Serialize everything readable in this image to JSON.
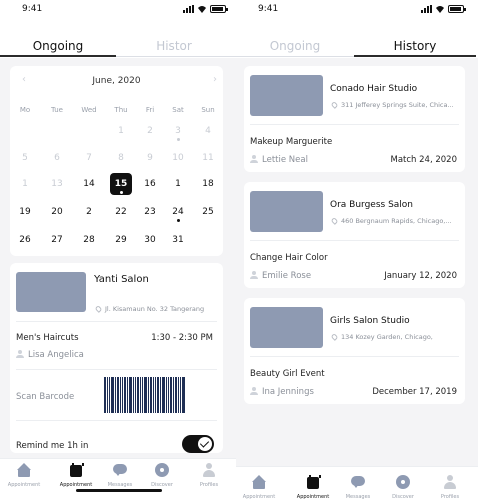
{
  "status_time": "9:41",
  "left": {
    "tabs": [
      {
        "label": "Ongoing"
      },
      {
        "label": "Histor"
      }
    ],
    "calendar": {
      "month": "June, 2020",
      "days_of_week": [
        "Mo",
        "Tue",
        "Wed",
        "Thu",
        "Fri",
        "Sat",
        "Sun"
      ],
      "weeks": [
        [
          {
            "d": "",
            "m": false,
            "dot": false
          },
          {
            "d": "",
            "m": false,
            "dot": false
          },
          {
            "d": "",
            "m": false,
            "dot": false
          },
          {
            "d": "1",
            "m": true,
            "dot": false
          },
          {
            "d": "2",
            "m": true,
            "dot": false
          },
          {
            "d": "3",
            "m": true,
            "dot": true
          },
          {
            "d": "4",
            "m": true,
            "dot": false
          }
        ],
        [
          {
            "d": "5",
            "m": true,
            "dot": false
          },
          {
            "d": "6",
            "m": true,
            "dot": false
          },
          {
            "d": "7",
            "m": true,
            "dot": false
          },
          {
            "d": "8",
            "m": true,
            "dot": false
          },
          {
            "d": "9",
            "m": true,
            "dot": false
          },
          {
            "d": "10",
            "m": true,
            "dot": false
          },
          {
            "d": "11",
            "m": true,
            "dot": false
          }
        ],
        [
          {
            "d": "1",
            "m": true,
            "dot": false
          },
          {
            "d": "13",
            "m": true,
            "dot": false
          },
          {
            "d": "14",
            "m": false,
            "dot": false
          },
          {
            "d": "15",
            "m": false,
            "dot": true,
            "sel": true
          },
          {
            "d": "16",
            "m": false,
            "dot": false
          },
          {
            "d": "1",
            "m": false,
            "dot": false
          },
          {
            "d": "18",
            "m": false,
            "dot": false
          }
        ],
        [
          {
            "d": "19",
            "m": false,
            "dot": false
          },
          {
            "d": "20",
            "m": false,
            "dot": false
          },
          {
            "d": "2",
            "m": false,
            "dot": false
          },
          {
            "d": "22",
            "m": false,
            "dot": false
          },
          {
            "d": "23",
            "m": false,
            "dot": false
          },
          {
            "d": "24",
            "m": false,
            "dot": true
          },
          {
            "d": "25",
            "m": false,
            "dot": false
          }
        ],
        [
          {
            "d": "26",
            "m": false,
            "dot": false
          },
          {
            "d": "27",
            "m": false,
            "dot": false
          },
          {
            "d": "28",
            "m": false,
            "dot": false
          },
          {
            "d": "29",
            "m": false,
            "dot": false
          },
          {
            "d": "30",
            "m": false,
            "dot": false
          },
          {
            "d": "31",
            "m": false,
            "dot": false
          },
          {
            "d": "",
            "m": false,
            "dot": false
          }
        ]
      ]
    },
    "appointment": {
      "salon": "Yanti Salon",
      "address": "Jl. Kisamaun No. 32 Tangerang",
      "service": "Men's Haircuts",
      "time": "1:30 - 2:30 PM",
      "stylist": "Lisa Angelica",
      "scan_label": "Scan Barcode",
      "remind_label": "Remind me 1h in"
    },
    "nav": [
      "Appointment",
      "Appointment",
      "Messages",
      "Discover",
      "Profiles"
    ]
  },
  "right": {
    "tabs": [
      {
        "label": "Ongoing"
      },
      {
        "label": "History"
      }
    ],
    "history": [
      {
        "salon": "Conado Hair Studio",
        "address": "311 Jefferey Springs Suite, Chica...",
        "service": "Makeup Marguerite",
        "stylist": "Lettie Neal",
        "date": "Match 24, 2020"
      },
      {
        "salon": "Ora Burgess Salon",
        "address": "460 Bergnaum Rapids, Chicago,...",
        "service": "Change Hair Color",
        "stylist": "Emilie Rose",
        "date": "January 12, 2020"
      },
      {
        "salon": "Girls Salon Studio",
        "address": "134 Kozey Garden, Chicago,",
        "service": "Beauty Girl Event",
        "stylist": "Ina Jennings",
        "date": "December 17, 2019"
      }
    ],
    "nav": [
      "Appointment",
      "Appointment",
      "Messages",
      "Discover",
      "Profiles"
    ]
  }
}
